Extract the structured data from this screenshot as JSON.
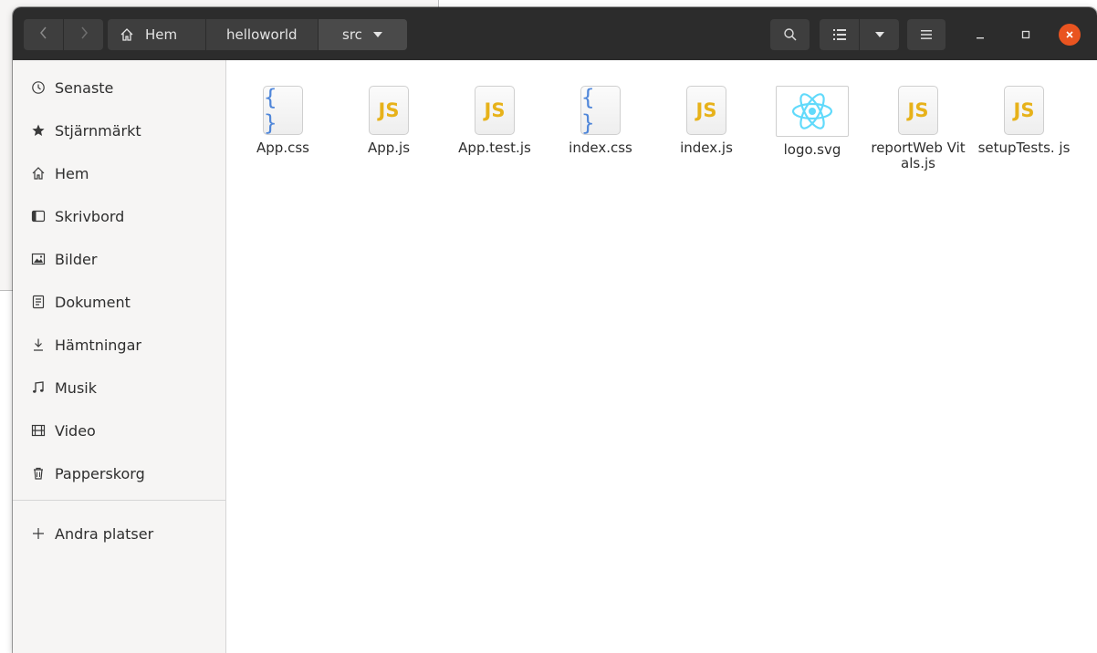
{
  "header": {
    "breadcrumbs": [
      {
        "label": "Hem"
      },
      {
        "label": "helloworld"
      },
      {
        "label": "src"
      }
    ]
  },
  "sidebar": {
    "items": [
      {
        "label": "Senaste",
        "icon": "clock-icon"
      },
      {
        "label": "Stjärnmärkt",
        "icon": "star-icon"
      },
      {
        "label": "Hem",
        "icon": "home-icon"
      },
      {
        "label": "Skrivbord",
        "icon": "desktop-icon"
      },
      {
        "label": "Bilder",
        "icon": "image-icon"
      },
      {
        "label": "Dokument",
        "icon": "document-icon"
      },
      {
        "label": "Hämtningar",
        "icon": "download-icon"
      },
      {
        "label": "Musik",
        "icon": "music-icon"
      },
      {
        "label": "Video",
        "icon": "video-icon"
      },
      {
        "label": "Papperskorg",
        "icon": "trash-icon"
      }
    ],
    "other_places": {
      "label": "Andra platser",
      "icon": "plus-icon"
    }
  },
  "files": [
    {
      "name": "App.css",
      "type": "css",
      "badge": "{ }"
    },
    {
      "name": "App.js",
      "type": "js",
      "badge": "JS"
    },
    {
      "name": "App.test.js",
      "type": "js",
      "badge": "JS"
    },
    {
      "name": "index.css",
      "type": "css",
      "badge": "{ }"
    },
    {
      "name": "index.js",
      "type": "js",
      "badge": "JS"
    },
    {
      "name": "logo.svg",
      "type": "svg",
      "badge": ""
    },
    {
      "name": "reportWeb Vitals.js",
      "type": "js",
      "badge": "JS"
    },
    {
      "name": "setupTests. js",
      "type": "js",
      "badge": "JS"
    }
  ],
  "colors": {
    "headerbar": "#2c2c2c",
    "close_button": "#e95420",
    "js_badge": "#e7b21a",
    "css_badge": "#4f86d9",
    "react_logo": "#61dafb"
  }
}
